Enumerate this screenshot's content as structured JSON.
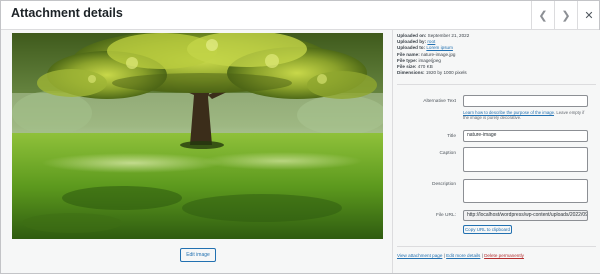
{
  "header": {
    "title": "Attachment details",
    "prev_icon": "chevron-left-icon",
    "next_icon": "chevron-right-icon",
    "close_icon": "close-icon"
  },
  "image_label": "nature-image",
  "edit_image_label": "Edit image",
  "meta": {
    "uploaded_on_label": "Uploaded on:",
    "uploaded_on": "September 21, 2022",
    "uploaded_by_label": "Uploaded by:",
    "uploaded_by": "root",
    "uploaded_to_label": "Uploaded to:",
    "uploaded_to": "Lorem ipsum",
    "file_name_label": "File name:",
    "file_name": "nature-image.jpg",
    "file_type_label": "File type:",
    "file_type": "image/jpeg",
    "file_size_label": "File size:",
    "file_size": "470 KB",
    "dimensions_label": "Dimensions:",
    "dimensions": "1920 by 1000 pixels"
  },
  "fields": {
    "alt_label": "Alternative Text",
    "alt_value": "",
    "alt_help_link": "Learn how to describe the purpose of the image",
    "alt_help_text": ". Leave empty if the image is purely decorative.",
    "title_label": "Title",
    "title_value": "nature-image",
    "caption_label": "Caption",
    "caption_value": "",
    "description_label": "Description",
    "description_value": "",
    "file_url_label": "File URL:",
    "file_url_value": "http://localhost/wordpress/wp-content/uploads/2022/09/nature-image.jpg",
    "copy_url_label": "Copy URL to clipboard"
  },
  "actions": {
    "view": "View attachment page",
    "edit_more": "Edit more details",
    "delete": "Delete permanently",
    "separator": " | "
  },
  "colors": {
    "link": "#2271b1",
    "delete": "#b32d2e",
    "panel_bg": "#f6f7f7",
    "border": "#dcdcde"
  }
}
